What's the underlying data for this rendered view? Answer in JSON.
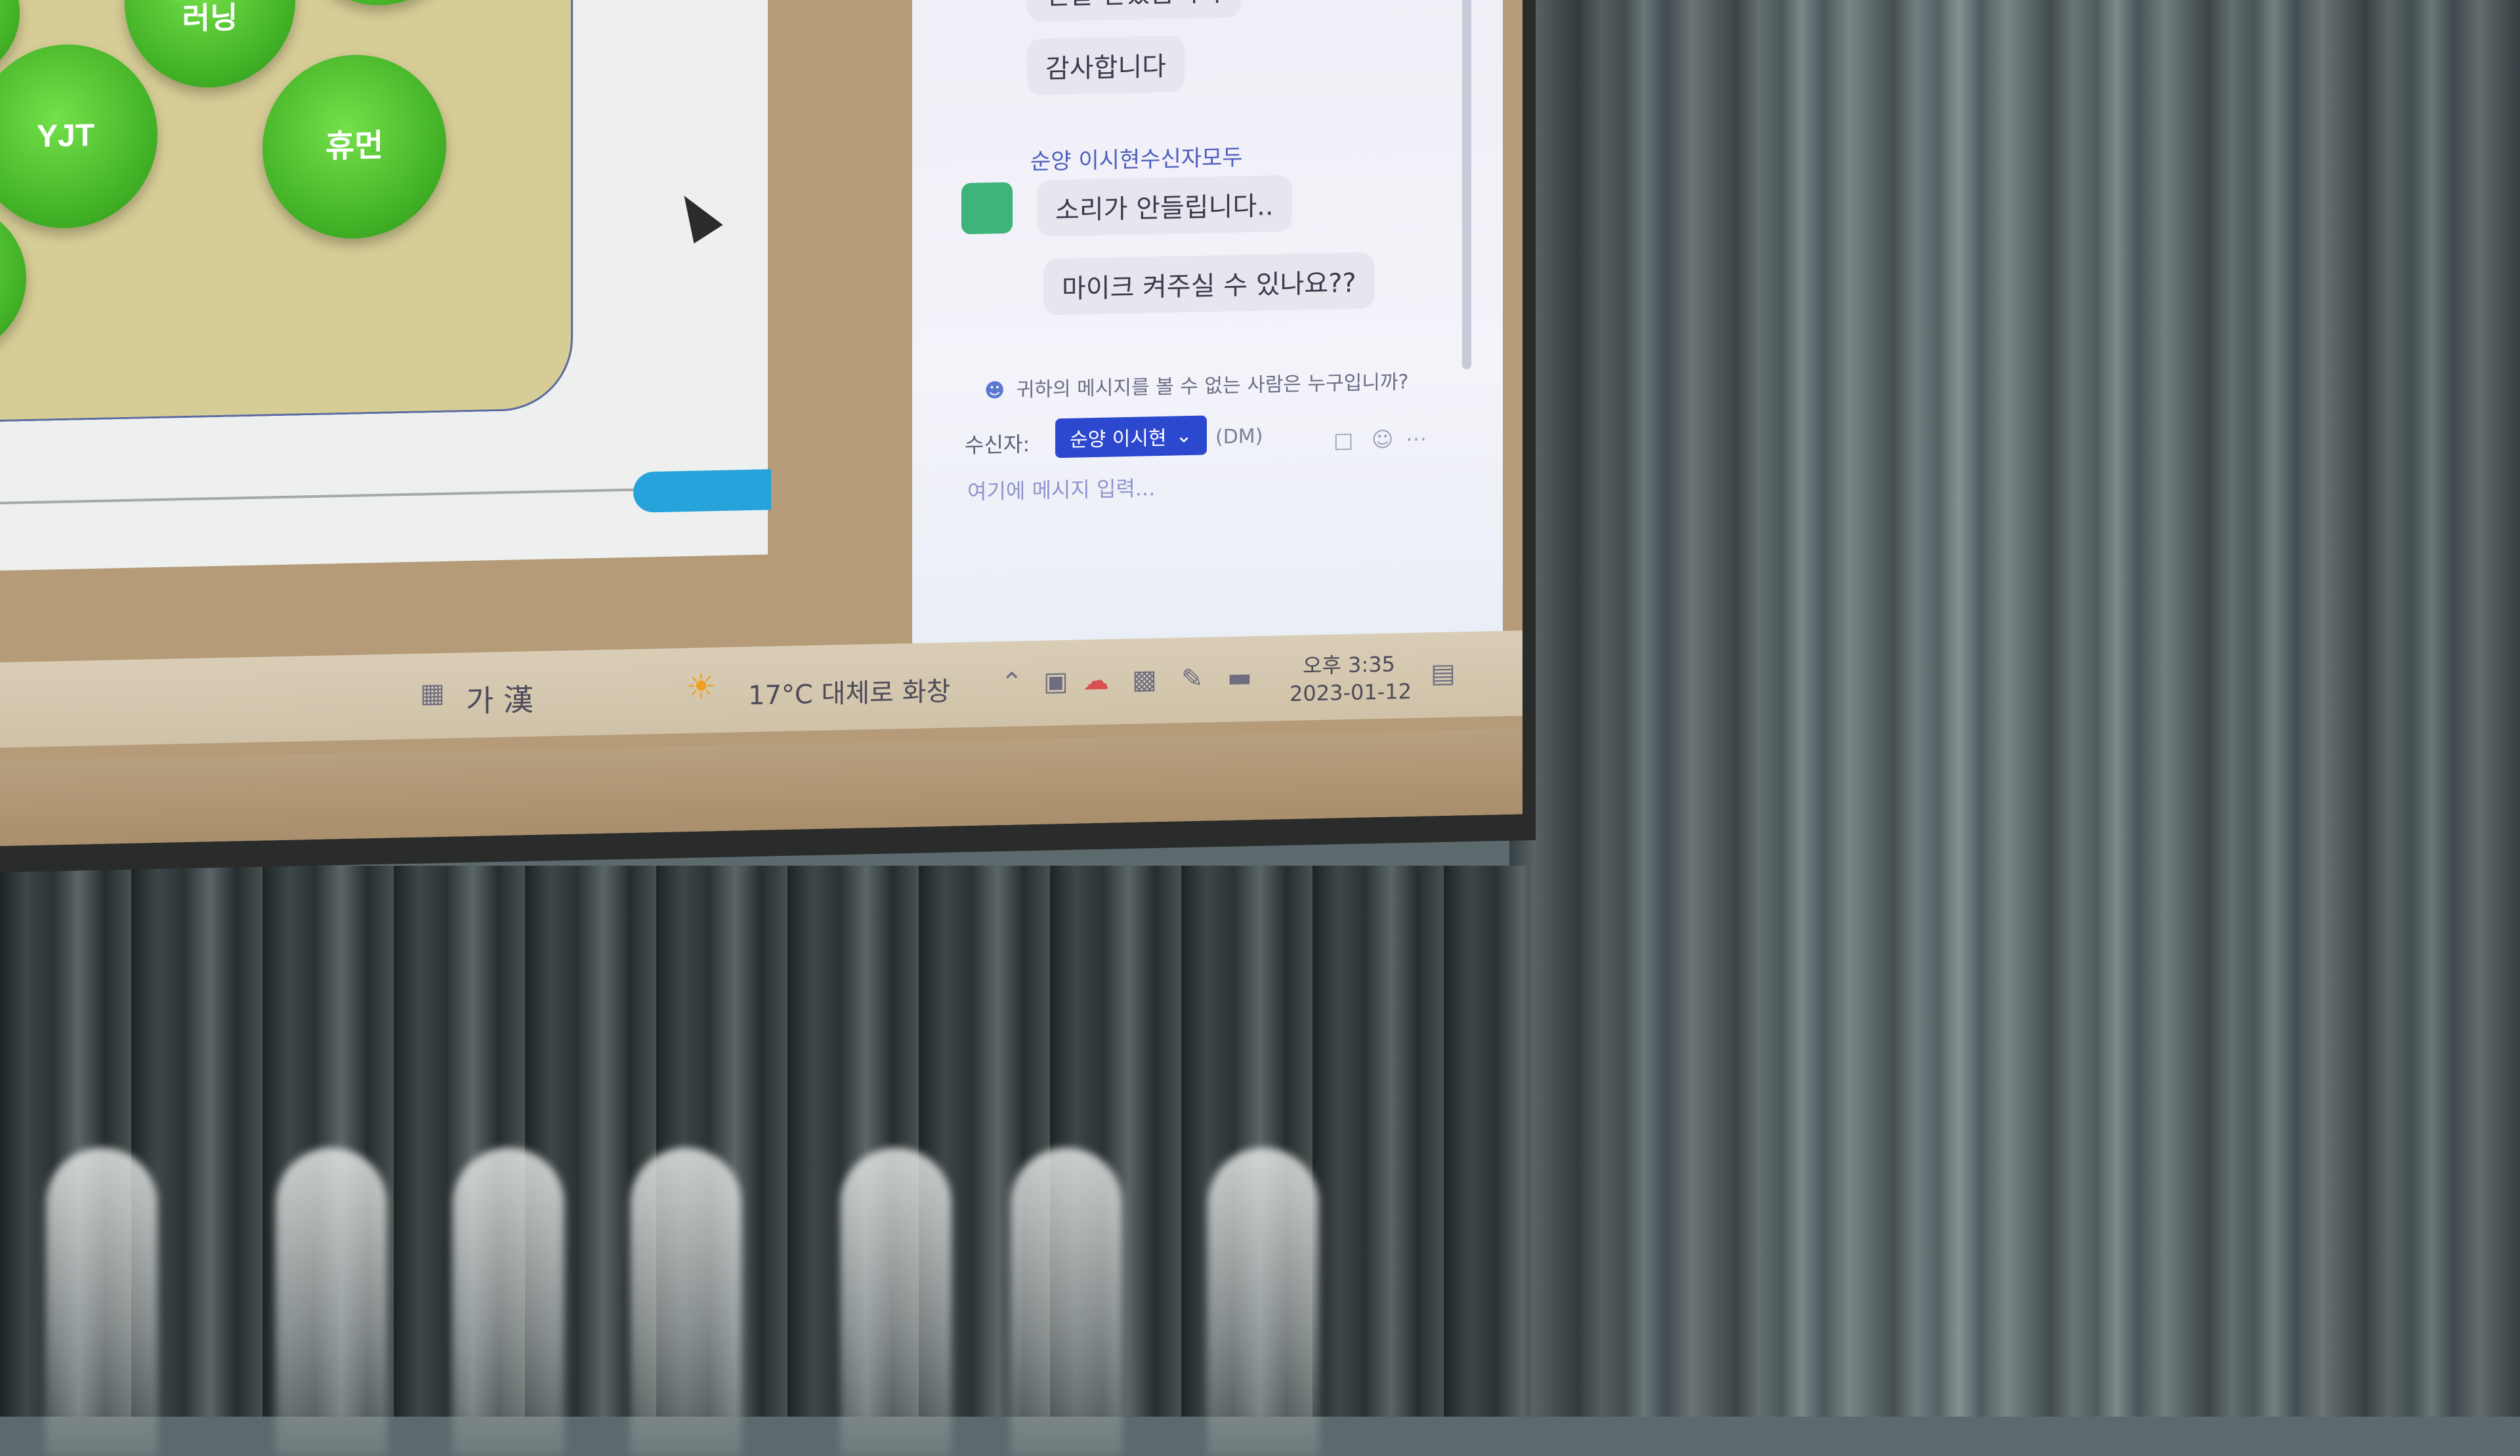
{
  "slide": {
    "bubbles": [
      {
        "label": "딥치즈\n러닝"
      },
      {
        "label": "YJT"
      },
      {
        "label": "휴먼"
      }
    ]
  },
  "chat": {
    "messages_top": [
      "전달 받았습니다",
      "감사합니다"
    ],
    "sender": "순양 이시현수신자모두",
    "messages_bottom": [
      "소리가 안들립니다..",
      "마이크 켜주실 수 있나요??"
    ],
    "visibility_notice": "귀하의 메시지를 볼 수 없는 사람은 누구입니까?",
    "recipient_label": "수신자:",
    "recipient_value": "순양 이시현",
    "dm_tag": "(DM)",
    "input_placeholder": "여기에 메시지 입력..."
  },
  "taskbar": {
    "ime": "가 漢",
    "weather": "17°C 대체로 화창",
    "time": "오후 3:35",
    "date": "2023-01-12"
  }
}
